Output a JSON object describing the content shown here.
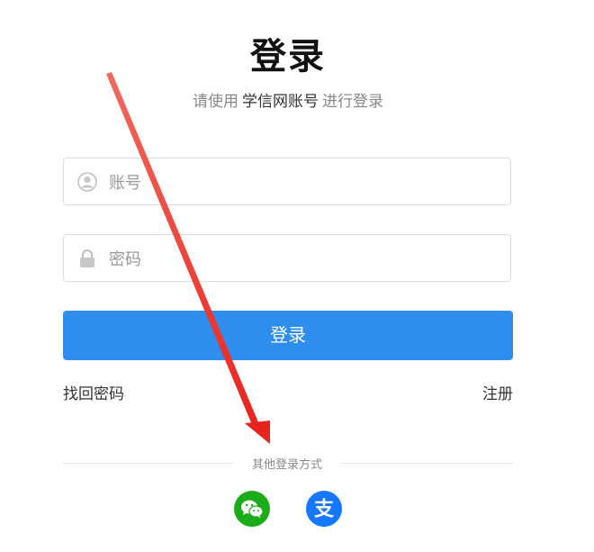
{
  "title": "登录",
  "subtitle": {
    "prefix": "请使用",
    "brand": "学信网账号",
    "suffix": "进行登录"
  },
  "form": {
    "account_placeholder": "账号",
    "password_placeholder": "密码",
    "login_label": "登录"
  },
  "links": {
    "forgot_password": "找回密码",
    "register": "注册"
  },
  "other_login": {
    "label": "其他登录方式",
    "methods": [
      {
        "name": "wechat-icon",
        "color": "#1aad19"
      },
      {
        "name": "alipay-icon",
        "color": "#1677ff",
        "glyph": "支"
      }
    ]
  },
  "colors": {
    "primary": "#2e8ded",
    "annotation_arrow": "#e8231d"
  }
}
